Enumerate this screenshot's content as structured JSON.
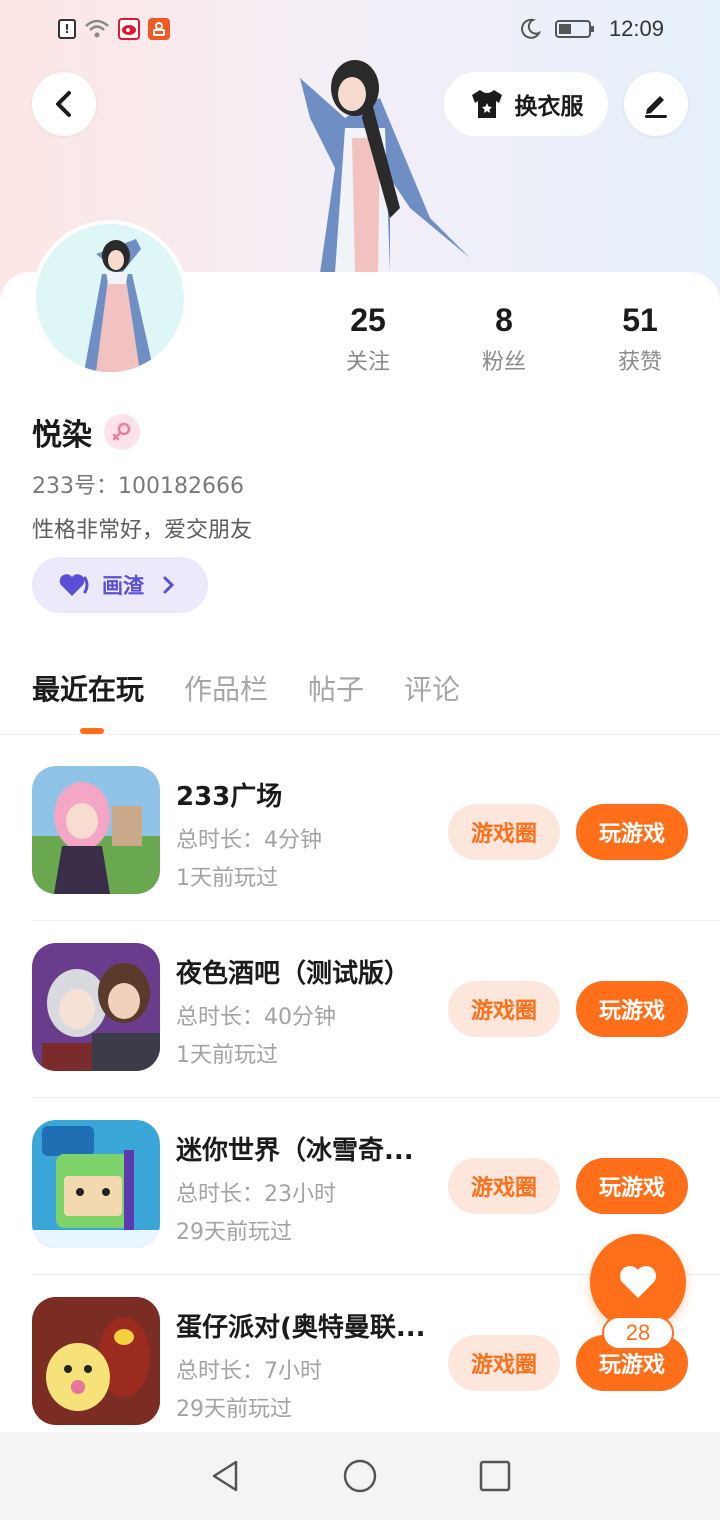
{
  "status_bar": {
    "time": "12:09",
    "icons": [
      "alert-icon",
      "wifi-icon",
      "weibo-icon",
      "app-icon",
      "moon-icon",
      "battery-icon"
    ]
  },
  "header": {
    "dress_label": "换衣服"
  },
  "profile": {
    "stats": [
      {
        "value": "25",
        "label": "关注"
      },
      {
        "value": "8",
        "label": "粉丝"
      },
      {
        "value": "51",
        "label": "获赞"
      }
    ],
    "name": "悦染",
    "uid": "233号：100182666",
    "bio": "性格非常好，爱交朋友",
    "badge": "画渣"
  },
  "tabs": [
    {
      "label": "最近在玩",
      "active": true
    },
    {
      "label": "作品栏",
      "active": false
    },
    {
      "label": "帖子",
      "active": false
    },
    {
      "label": "评论",
      "active": false
    }
  ],
  "games": [
    {
      "title": "233广场",
      "duration": "总时长：4分钟",
      "last_played": "1天前玩过",
      "circle_label": "游戏圈",
      "play_label": "玩游戏"
    },
    {
      "title": "夜色酒吧（测试版）",
      "duration": "总时长：40分钟",
      "last_played": "1天前玩过",
      "circle_label": "游戏圈",
      "play_label": "玩游戏"
    },
    {
      "title": "迷你世界（冰雪奇...",
      "duration": "总时长：23小时",
      "last_played": "29天前玩过",
      "circle_label": "游戏圈",
      "play_label": "玩游戏"
    },
    {
      "title": "蛋仔派对(奥特曼联...",
      "duration": "总时长：7小时",
      "last_played": "29天前玩过",
      "circle_label": "游戏圈",
      "play_label": "玩游戏"
    }
  ],
  "like_count": "28",
  "colors": {
    "accent": "#ff6f1a",
    "badge_purple": "#5b4fd6"
  }
}
